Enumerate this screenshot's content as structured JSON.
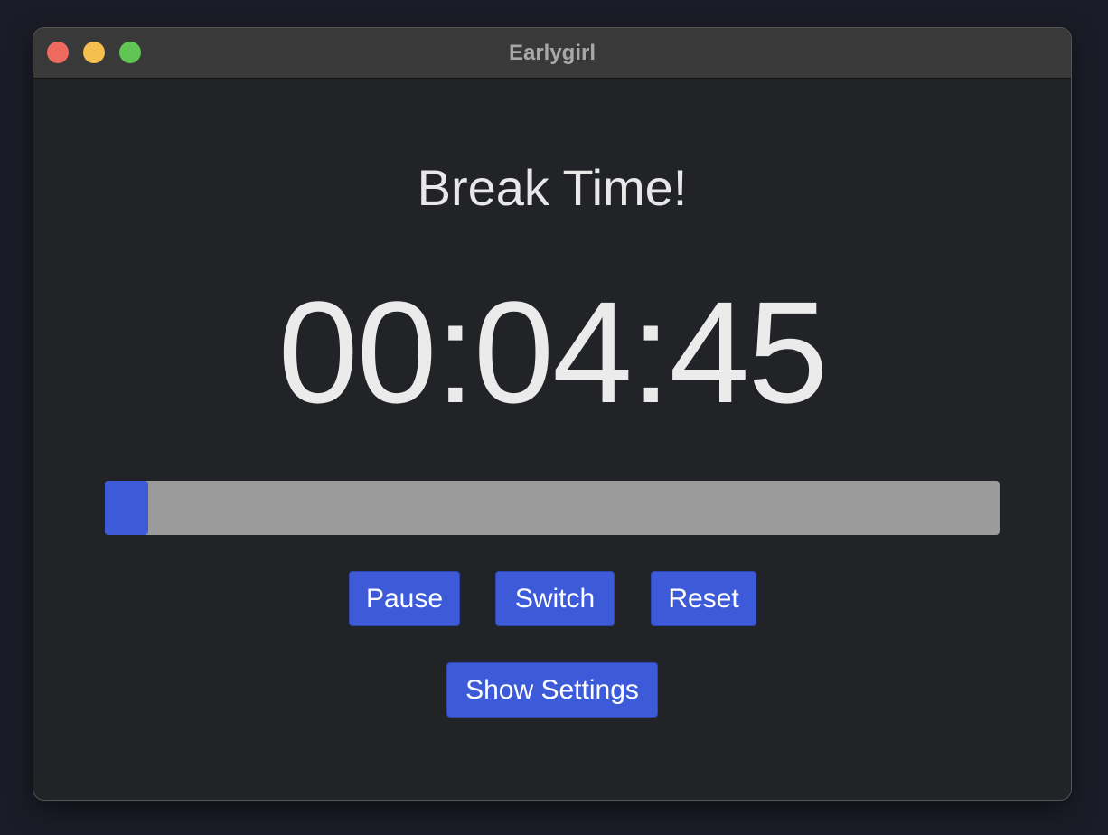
{
  "window": {
    "title": "Earlygirl"
  },
  "main": {
    "heading": "Break Time!",
    "timer": "00:04:45",
    "progress_fraction": 0.048
  },
  "buttons": {
    "pause_label": "Pause",
    "switch_label": "Switch",
    "reset_label": "Reset",
    "settings_label": "Show Settings"
  },
  "colors": {
    "accent": "#3d5ad8",
    "progress_track": "#9b9b9b",
    "background": "#222327",
    "titlebar": "#393939"
  }
}
